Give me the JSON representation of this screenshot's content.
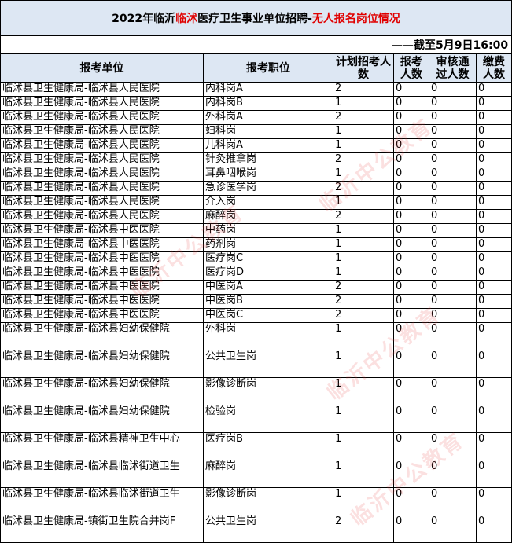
{
  "title": {
    "prefix": "2022年临沂",
    "red1": "临沭",
    "middle": "医疗卫生事业单位招聘-",
    "red2": "无人报名岗位情况"
  },
  "deadline": "——截至5月9日16:00",
  "headers": {
    "unit": "报考单位",
    "position": "报考职位",
    "plan": "计划招考人数",
    "applied": "报考人数",
    "approved": "审核通过人数",
    "paid": "缴费人数"
  },
  "rows": [
    {
      "unit": "临沭县卫生健康局-临沭县人民医院",
      "position": "内科岗A",
      "plan": "2",
      "applied": "0",
      "approved": "0",
      "paid": "0"
    },
    {
      "unit": "临沭县卫生健康局-临沭县人民医院",
      "position": "内科岗B",
      "plan": "1",
      "applied": "0",
      "approved": "0",
      "paid": "0"
    },
    {
      "unit": "临沭县卫生健康局-临沭县人民医院",
      "position": "外科岗A",
      "plan": "2",
      "applied": "0",
      "approved": "0",
      "paid": "0"
    },
    {
      "unit": "临沭县卫生健康局-临沭县人民医院",
      "position": "妇科岗",
      "plan": "1",
      "applied": "0",
      "approved": "0",
      "paid": "0"
    },
    {
      "unit": "临沭县卫生健康局-临沭县人民医院",
      "position": "儿科岗A",
      "plan": "1",
      "applied": "0",
      "approved": "0",
      "paid": "0"
    },
    {
      "unit": "临沭县卫生健康局-临沭县人民医院",
      "position": "针灸推拿岗",
      "plan": "2",
      "applied": "0",
      "approved": "0",
      "paid": "0"
    },
    {
      "unit": "临沭县卫生健康局-临沭县人民医院",
      "position": "耳鼻咽喉岗",
      "plan": "1",
      "applied": "0",
      "approved": "0",
      "paid": "0"
    },
    {
      "unit": "临沭县卫生健康局-临沭县人民医院",
      "position": "急诊医学岗",
      "plan": "2",
      "applied": "0",
      "approved": "0",
      "paid": "0"
    },
    {
      "unit": "临沭县卫生健康局-临沭县人民医院",
      "position": "介入岗",
      "plan": "1",
      "applied": "0",
      "approved": "0",
      "paid": "0"
    },
    {
      "unit": "临沭县卫生健康局-临沭县人民医院",
      "position": "麻醉岗",
      "plan": "2",
      "applied": "0",
      "approved": "0",
      "paid": "0"
    },
    {
      "unit": "临沭县卫生健康局-临沭县中医医院",
      "position": "中药岗",
      "plan": "1",
      "applied": "0",
      "approved": "0",
      "paid": "0"
    },
    {
      "unit": "临沭县卫生健康局-临沭县中医医院",
      "position": "药剂岗",
      "plan": "1",
      "applied": "0",
      "approved": "0",
      "paid": "0"
    },
    {
      "unit": "临沭县卫生健康局-临沭县中医医院",
      "position": "医疗岗C",
      "plan": "1",
      "applied": "0",
      "approved": "0",
      "paid": "0"
    },
    {
      "unit": "临沭县卫生健康局-临沭县中医医院",
      "position": "医疗岗D",
      "plan": "1",
      "applied": "0",
      "approved": "0",
      "paid": "0"
    },
    {
      "unit": "临沭县卫生健康局-临沭县中医医院",
      "position": "中医岗A",
      "plan": "2",
      "applied": "0",
      "approved": "0",
      "paid": "0"
    },
    {
      "unit": "临沭县卫生健康局-临沭县中医医院",
      "position": "中医岗B",
      "plan": "2",
      "applied": "0",
      "approved": "0",
      "paid": "0"
    },
    {
      "unit": "临沭县卫生健康局-临沭县中医医院",
      "position": "中医岗C",
      "plan": "2",
      "applied": "0",
      "approved": "0",
      "paid": "0"
    },
    {
      "unit": "临沭县卫生健康局-临沭县妇幼保健院",
      "position": "外科岗",
      "plan": "1",
      "applied": "0",
      "approved": "0",
      "paid": "0"
    },
    {
      "unit": "临沭县卫生健康局-临沭县妇幼保健院",
      "position": "公共卫生岗",
      "plan": "1",
      "applied": "0",
      "approved": "0",
      "paid": "0"
    },
    {
      "unit": "临沭县卫生健康局-临沭县妇幼保健院",
      "position": "影像诊断岗",
      "plan": "1",
      "applied": "0",
      "approved": "0",
      "paid": "0"
    },
    {
      "unit": "临沭县卫生健康局-临沭县妇幼保健院",
      "position": "检验岗",
      "plan": "1",
      "applied": "0",
      "approved": "0",
      "paid": "0"
    },
    {
      "unit": "临沭县卫生健康局-临沭县精神卫生中心",
      "position": "医疗岗B",
      "plan": "1",
      "applied": "0",
      "approved": "0",
      "paid": "0"
    },
    {
      "unit": "临沭县卫生健康局-临沭县临沭街道卫生",
      "position": "麻醉岗",
      "plan": "1",
      "applied": "0",
      "approved": "0",
      "paid": "0"
    },
    {
      "unit": "临沭县卫生健康局-临沭县临沭街道卫生",
      "position": "影像诊断岗",
      "plan": "1",
      "applied": "0",
      "approved": "0",
      "paid": "0"
    },
    {
      "unit": "临沭县卫生健康局-镇街卫生院合并岗F",
      "position": "公共卫生岗",
      "plan": "2",
      "applied": "0",
      "approved": "0",
      "paid": "0"
    }
  ],
  "watermark": "临沂中公教育"
}
